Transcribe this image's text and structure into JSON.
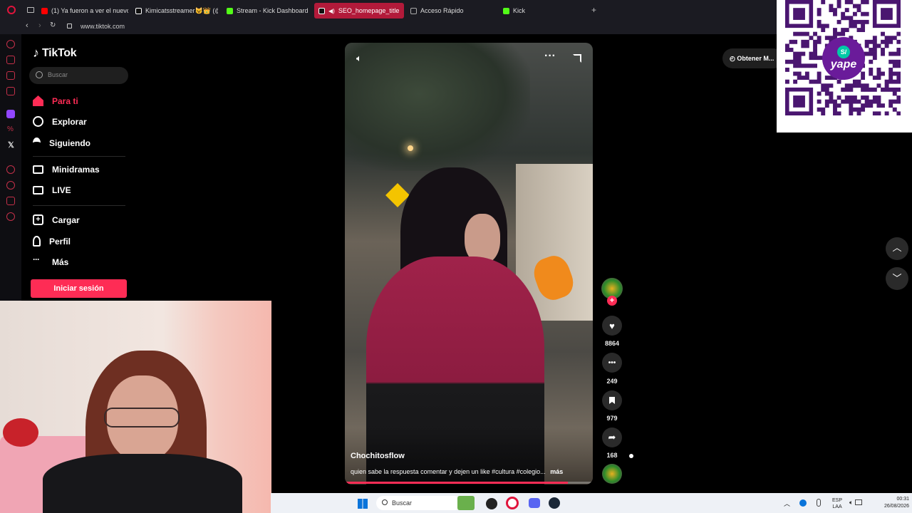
{
  "browser": {
    "tabs": [
      {
        "label": "(1) Ya fueron a ver el nuevo",
        "color": "#ff0000"
      },
      {
        "label": "Kimicatsstreamer😺👑 (@k",
        "color": "#ffffff"
      },
      {
        "label": "Stream - Kick Dashboard",
        "color": "#53fc18"
      },
      {
        "label": "SEO_homepage_title",
        "color": "#ffffff"
      },
      {
        "label": "Acceso Rápido",
        "color": "#aaaaaa"
      },
      {
        "label": "Kick",
        "color": "#53fc18"
      }
    ],
    "new_tab": "+",
    "url": "www.tiktok.com"
  },
  "tiktok": {
    "logo": "TikTok",
    "search_placeholder": "Buscar",
    "nav": [
      {
        "label": "Para ti",
        "icon": "home-icon"
      },
      {
        "label": "Explorar",
        "icon": "compass-icon"
      },
      {
        "label": "Siguiendo",
        "icon": "following-icon"
      },
      {
        "label": "Minidramas",
        "icon": "film-icon"
      },
      {
        "label": "LIVE",
        "icon": "live-tv-icon"
      },
      {
        "label": "Cargar",
        "icon": "upload-icon"
      },
      {
        "label": "Perfil",
        "icon": "profile-icon"
      },
      {
        "label": "Más",
        "icon": "more-icon"
      }
    ],
    "login_button": "Iniciar sesión",
    "get_app": "Obtener M...",
    "video": {
      "author": "Chochitosflow",
      "caption": "quien sabe la respuesta comentar  y dejen un like #cultura #colegio...",
      "more": "más",
      "likes": "8864",
      "comments": "249",
      "saves": "979",
      "shares": "168",
      "progress": 0.9
    }
  },
  "overlay": {
    "qr_brand": "yape",
    "qr_badge": "S/"
  },
  "taskbar": {
    "search": "Buscar",
    "lang_top": "ESP",
    "lang_bottom": "LAA",
    "time": "00:31",
    "date": "26/08/2026"
  },
  "colors": {
    "accent": "#fe2c55",
    "opera": "#c43049",
    "tab_active": "#b21a3a"
  }
}
